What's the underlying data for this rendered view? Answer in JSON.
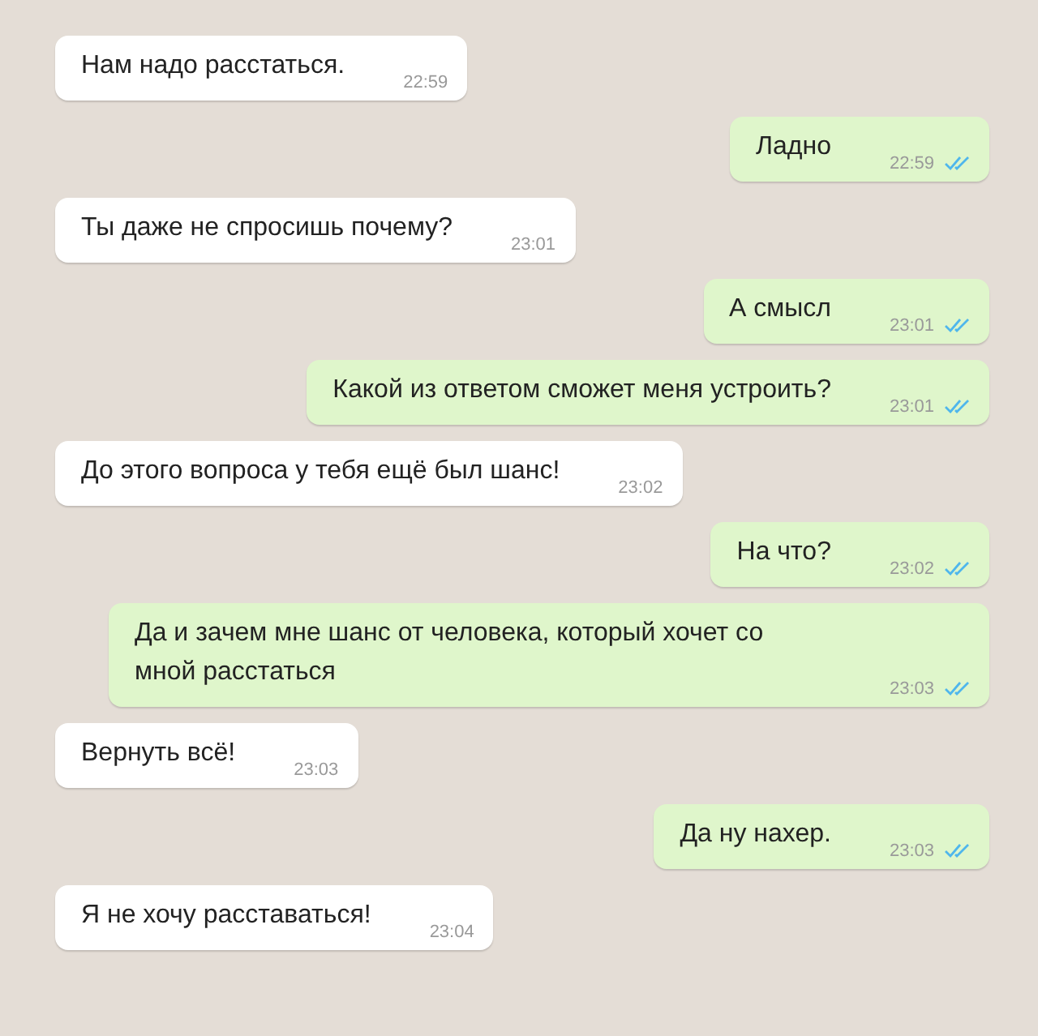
{
  "messages": [
    {
      "kind": "in",
      "text": "Нам надо расстаться.",
      "time": "22:59"
    },
    {
      "kind": "out",
      "text": "Ладно",
      "time": "22:59",
      "read": true
    },
    {
      "kind": "in",
      "text": "Ты даже не спросишь почему?",
      "time": "23:01"
    },
    {
      "kind": "out",
      "text": "А смысл",
      "time": "23:01",
      "read": true
    },
    {
      "kind": "out",
      "text": "Какой из ответом сможет меня устроить?",
      "time": "23:01",
      "read": true
    },
    {
      "kind": "in",
      "text": "До этого вопроса у тебя ещё был шанс!",
      "time": "23:02"
    },
    {
      "kind": "out",
      "text": "На что?",
      "time": "23:02",
      "read": true
    },
    {
      "kind": "out",
      "text": "Да и зачем мне шанс от человека, который хочет со мной расстаться",
      "time": "23:03",
      "read": true
    },
    {
      "kind": "in",
      "text": "Вернуть всё!",
      "time": "23:03"
    },
    {
      "kind": "out",
      "text": "Да ну нахер.",
      "time": "23:03",
      "read": true
    },
    {
      "kind": "in",
      "text": "Я не хочу расставаться!",
      "time": "23:04"
    }
  ]
}
